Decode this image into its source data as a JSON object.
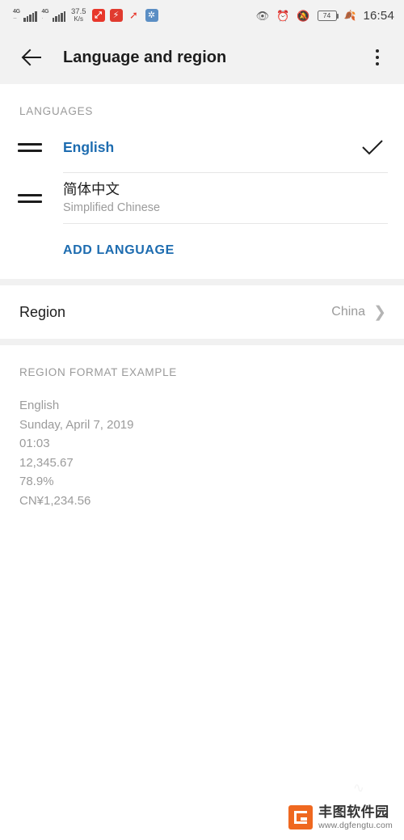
{
  "status_bar": {
    "network_1": {
      "gen": "4G",
      "icon": "signal-bars-icon"
    },
    "network_2": {
      "gen": "4G",
      "icon": "signal-bars-icon"
    },
    "data_speed": {
      "value": "37.5",
      "unit": "K/s"
    },
    "notification_icons": [
      "stock-app-icon",
      "alert-app-icon",
      "trend-arrow-icon",
      "network-app-icon"
    ],
    "eye_comfort_icon": "eye-comfort-icon",
    "alarm_icon": "alarm-clock-icon",
    "silent_icon": "bell-muted-icon",
    "battery": {
      "level": "74",
      "icon": "battery-icon"
    },
    "power_save_icon": "leaf-icon",
    "time": "16:54"
  },
  "app_bar": {
    "back_icon": "back-arrow-icon",
    "title": "Language and region",
    "overflow_icon": "more-vertical-icon"
  },
  "languages_section": {
    "header": "LANGUAGES",
    "items": [
      {
        "name": "English",
        "subtitle": "",
        "selected": true,
        "drag_handle_icon": "drag-handle-icon",
        "check_icon": "check-icon"
      },
      {
        "name": "简体中文",
        "subtitle": "Simplified Chinese",
        "selected": false,
        "drag_handle_icon": "drag-handle-icon",
        "check_icon": ""
      }
    ],
    "add_language_label": "ADD LANGUAGE",
    "accent_color": "#1d6cb0"
  },
  "region_section": {
    "label": "Region",
    "value": "China",
    "chevron_icon": "chevron-right-icon"
  },
  "format_example_section": {
    "header": "REGION FORMAT EXAMPLE",
    "lines": [
      "English",
      "Sunday, April 7, 2019",
      "01:03",
      "12,345.67",
      "78.9%",
      "CN¥1,234.56"
    ]
  },
  "watermark": {
    "logo_icon": "fengtu-logo-icon",
    "name": "丰图软件园",
    "url": "www.dgfengtu.com",
    "brand_color": "#ef6820"
  }
}
